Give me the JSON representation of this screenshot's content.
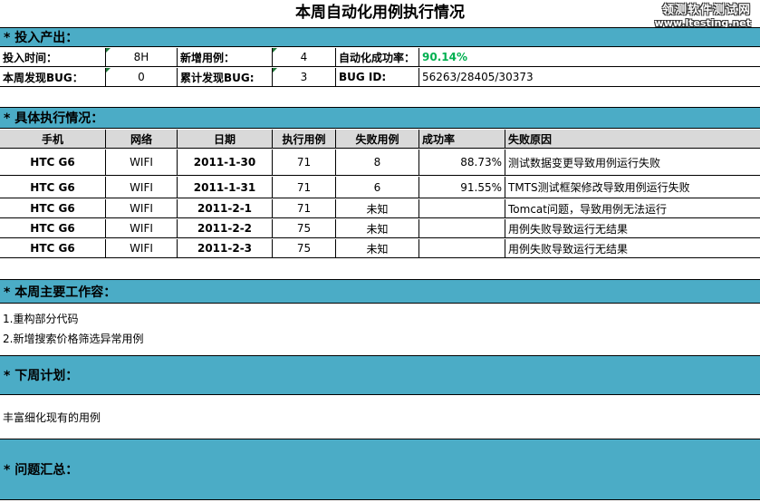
{
  "title": "本周自动化用例执行情况",
  "watermark": {
    "line1": "领测软件测试网",
    "line2": "www.ltesting.net"
  },
  "sections": {
    "input_output": "* 投入产出：",
    "execution": "* 具体执行情况：",
    "work": "* 本周主要工作容：",
    "next_plan": "* 下周计划：",
    "issues": "* 问题汇总："
  },
  "summary": {
    "row1": {
      "time_label": "投入时间：",
      "time_value": "8H",
      "new_cases_label": "新增用例：",
      "new_cases_value": "4",
      "success_label": "自动化成功率：",
      "success_value": "90.14%"
    },
    "row2": {
      "bug_week_label": "本周发现BUG：",
      "bug_week_value": "0",
      "bug_total_label": "累计发现BUG:",
      "bug_total_value": "3",
      "bug_id_label": "BUG ID:",
      "bug_id_value": "56263/28405/30373"
    }
  },
  "table": {
    "headers": [
      "手机",
      "网络",
      "日期",
      "执行用例",
      "失败用例",
      "成功率",
      "失败原因"
    ],
    "rows": [
      {
        "phone": "HTC G6",
        "network": "WIFI",
        "date": "2011-1-30",
        "executed": "71",
        "failed": "8",
        "rate": "88.73%",
        "reason": "测试数据变更导致用例运行失败"
      },
      {
        "phone": "HTC G6",
        "network": "WIFI",
        "date": "2011-1-31",
        "executed": "71",
        "failed": "6",
        "rate": "91.55%",
        "reason": "TMTS测试框架修改导致用例运行失败"
      },
      {
        "phone": "HTC G6",
        "network": "WIFI",
        "date": "2011-2-1",
        "executed": "71",
        "failed": "未知",
        "rate": "",
        "reason": "Tomcat问题，导致用例无法运行"
      },
      {
        "phone": "HTC G6",
        "network": "WIFI",
        "date": "2011-2-2",
        "executed": "75",
        "failed": "未知",
        "rate": "",
        "reason": "用例失败导致运行无结果"
      },
      {
        "phone": "HTC G6",
        "network": "WIFI",
        "date": "2011-2-3",
        "executed": "75",
        "failed": "未知",
        "rate": "",
        "reason": "用例失败导致运行无结果"
      }
    ]
  },
  "work_items": [
    "1.重构部分代码",
    "2.新增搜索价格筛选异常用例"
  ],
  "next_plan_text": "丰富细化现有的用例",
  "colors": {
    "section_bg": "#4bacc6",
    "header_bg": "#d9d9d9",
    "success_green": "#00b050"
  }
}
